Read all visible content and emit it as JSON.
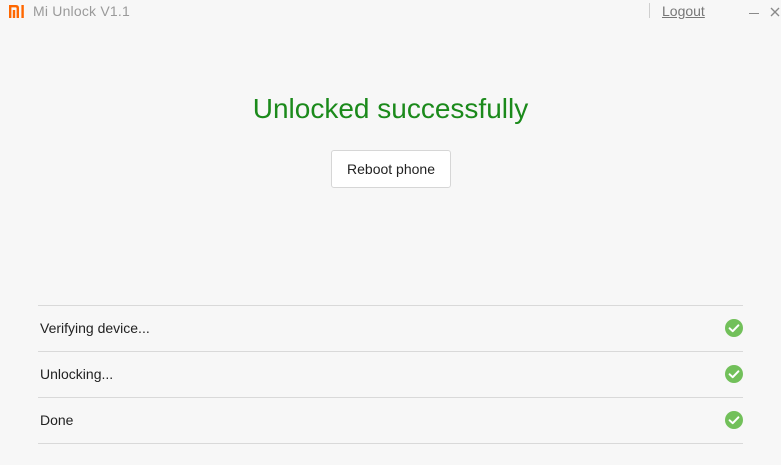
{
  "app": {
    "title": "Mi Unlock  V1.1",
    "logo_icon": "mi-logo-icon",
    "brand_color": "#ff6700"
  },
  "titlebar": {
    "logout_label": "Logout",
    "minimize_icon": "minimize-icon",
    "close_icon": "close-icon"
  },
  "main": {
    "headline": "Unlocked successfully",
    "headline_color": "#1b8a1b",
    "reboot_button_label": "Reboot phone"
  },
  "steps": [
    {
      "label": "Verifying device...",
      "status": "done",
      "icon": "check-circle-icon"
    },
    {
      "label": "Unlocking...",
      "status": "done",
      "icon": "check-circle-icon"
    },
    {
      "label": "Done",
      "status": "done",
      "icon": "check-circle-icon"
    }
  ],
  "colors": {
    "check_green": "#72c05a",
    "background": "#f7f7f7"
  }
}
